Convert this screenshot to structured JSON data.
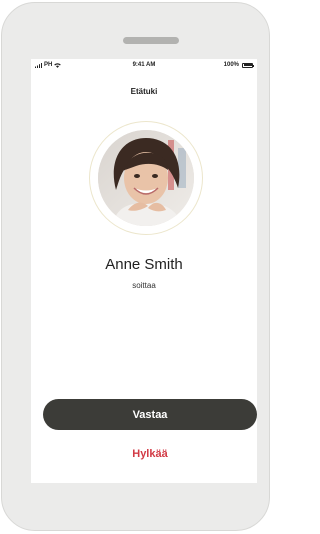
{
  "status_bar": {
    "carrier": "PH",
    "time": "9:41 AM",
    "battery": "100%",
    "battery_level": 1.0
  },
  "screen": {
    "title": "Etätuki"
  },
  "caller": {
    "name": "Anne Smith",
    "status": "soittaa",
    "ring_color": "#ece6cc"
  },
  "actions": {
    "answer_label": "Vastaa",
    "answer_color": "#3c3c38",
    "decline_label": "Hylkää",
    "decline_color": "#d23a45"
  }
}
